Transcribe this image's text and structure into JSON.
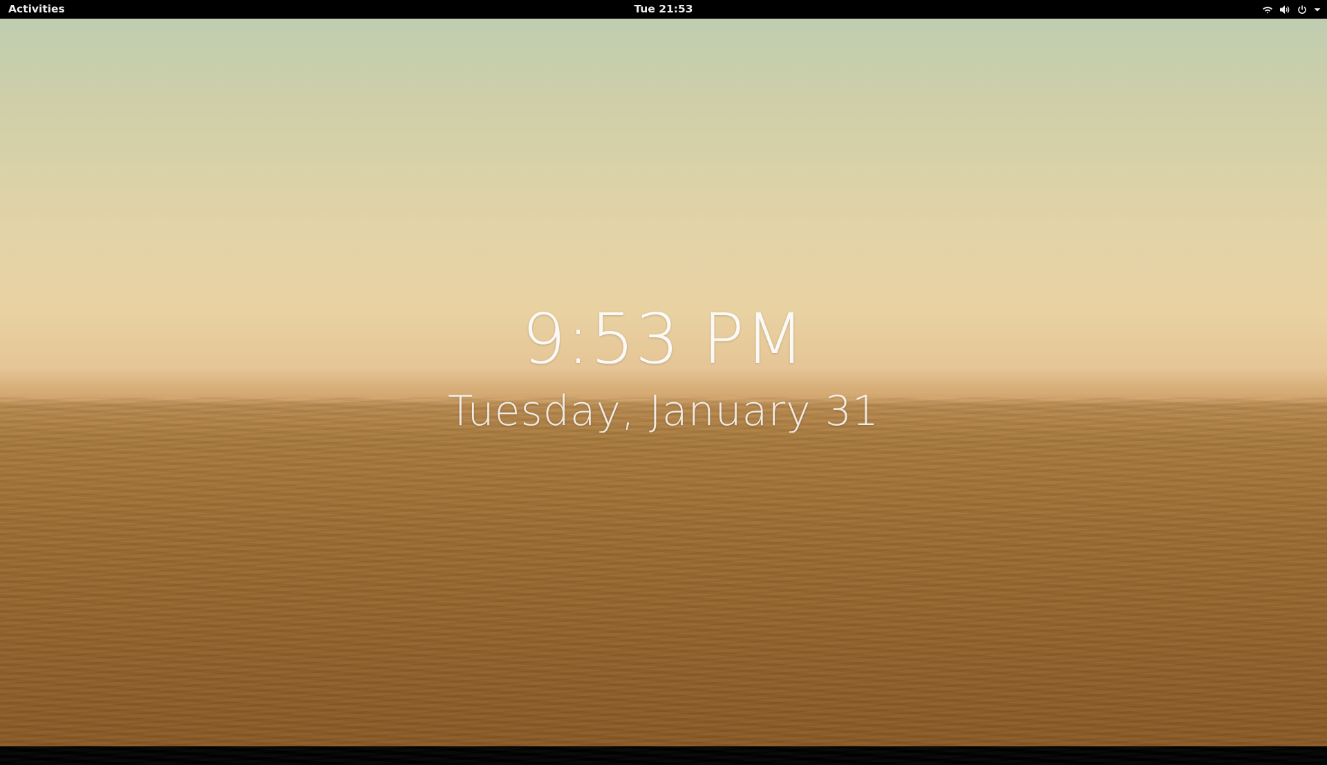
{
  "topbar": {
    "activities_label": "Activities",
    "clock_label": "Tue 21:53",
    "status_icons": [
      "wifi-icon",
      "volume-icon",
      "power-icon",
      "dropdown-arrow-icon"
    ]
  },
  "lock_screen": {
    "time": "9:53 PM",
    "date": "Tuesday, January 31"
  },
  "colors": {
    "topbar_bg": "#000000",
    "topbar_text": "#eeeeec",
    "sky_top": "#bfcdb0",
    "sky_mid": "#e9d2a2",
    "sand": "#9d6d33"
  }
}
